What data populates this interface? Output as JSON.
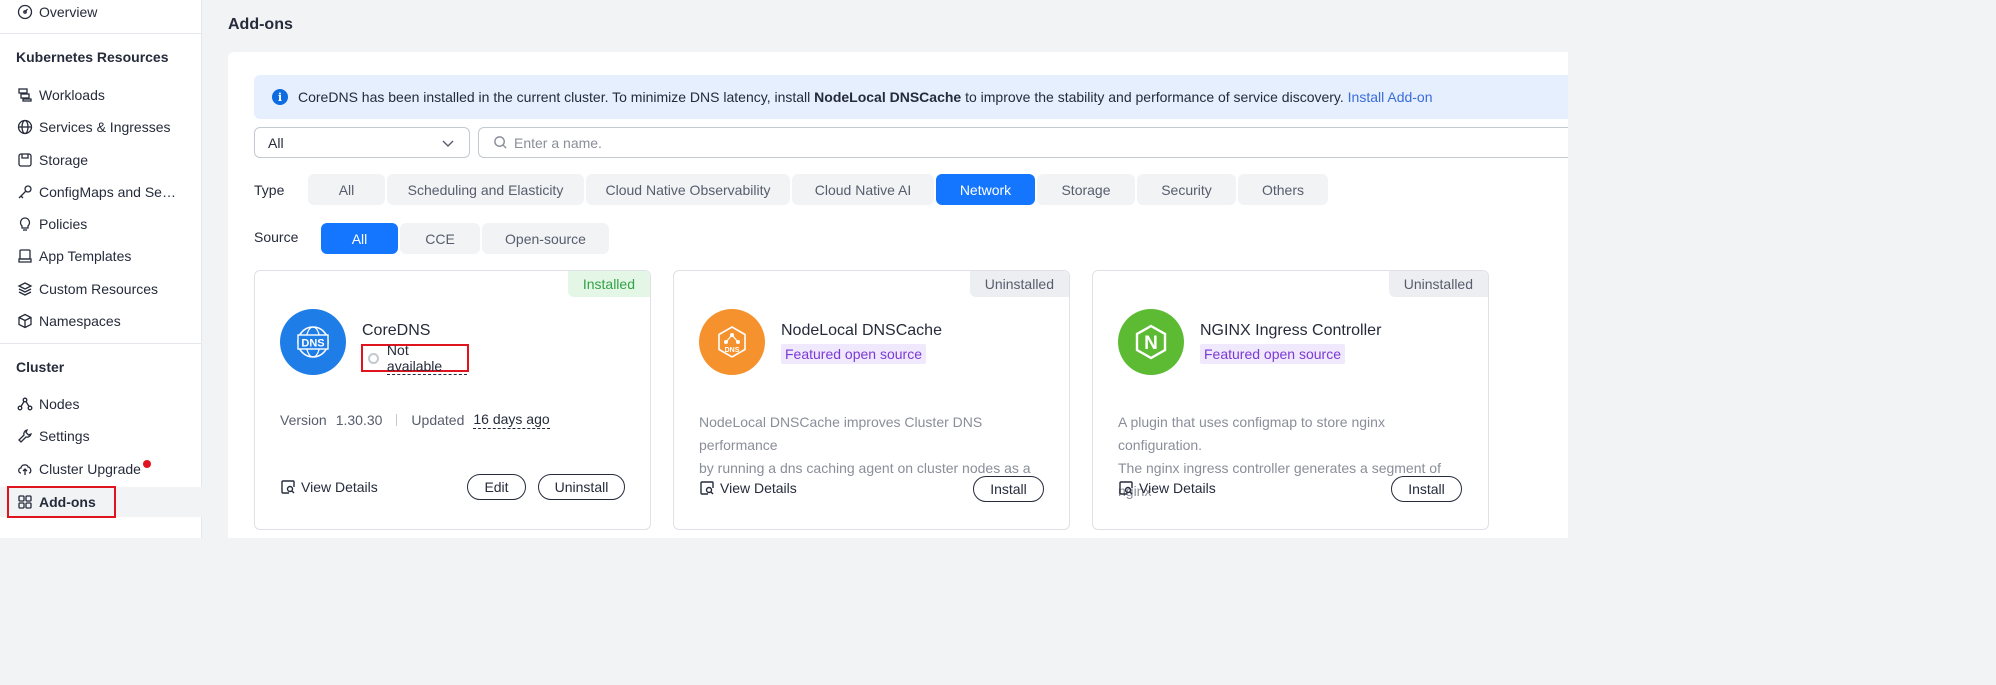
{
  "sidebar": {
    "overview": "Overview",
    "k8s_section": "Kubernetes Resources",
    "k8s_items": [
      {
        "label": "Workloads",
        "icon": "workloads-icon"
      },
      {
        "label": "Services & Ingresses",
        "icon": "globe-icon"
      },
      {
        "label": "Storage",
        "icon": "storage-icon"
      },
      {
        "label": "ConfigMaps and Se…",
        "icon": "key-icon"
      },
      {
        "label": "Policies",
        "icon": "lightbulb-icon"
      },
      {
        "label": "App Templates",
        "icon": "template-icon"
      },
      {
        "label": "Custom Resources",
        "icon": "layers-icon"
      },
      {
        "label": "Namespaces",
        "icon": "cube-icon"
      }
    ],
    "cluster_section": "Cluster",
    "cluster_items": [
      {
        "label": "Nodes",
        "icon": "nodes-icon"
      },
      {
        "label": "Settings",
        "icon": "wrench-icon"
      },
      {
        "label": "Cluster Upgrade",
        "icon": "cloud-upload-icon"
      },
      {
        "label": "Add-ons",
        "icon": "grid-icon"
      }
    ]
  },
  "main": {
    "title": "Add-ons",
    "banner": {
      "text_before": "CoreDNS has been installed in the current cluster. To minimize DNS latency, install ",
      "bold": "NodeLocal DNSCache",
      "text_after": " to improve the stability and performance of service discovery. ",
      "link": "Install Add-on"
    },
    "select_value": "All",
    "search_placeholder": "Enter a name.",
    "type_label": "Type",
    "type_filters": [
      "All",
      "Scheduling and Elasticity",
      "Cloud Native Observability",
      "Cloud Native AI",
      "Network",
      "Storage",
      "Security",
      "Others"
    ],
    "type_active": "Network",
    "source_label": "Source",
    "source_filters": [
      "All",
      "CCE",
      "Open-source"
    ],
    "source_active": "All"
  },
  "cards": [
    {
      "name": "CoreDNS",
      "status": "Installed",
      "state": "Not available",
      "version_label": "Version",
      "version": "1.30.30",
      "updated_label": "Updated",
      "updated": "16 days ago",
      "view_details": "View Details",
      "edit": "Edit",
      "uninstall": "Uninstall",
      "logo_color": "#1f7de8",
      "logo_text": "DNS"
    },
    {
      "name": "NodeLocal DNSCache",
      "status": "Uninstalled",
      "tag": "Featured open source",
      "desc_line1": "NodeLocal DNSCache improves Cluster DNS performance",
      "desc_line2": "by running a dns caching agent on cluster nodes as a",
      "view_details": "View Details",
      "install": "Install",
      "logo_color": "#f5922e",
      "logo_text": "DNS"
    },
    {
      "name": "NGINX Ingress Controller",
      "status": "Uninstalled",
      "tag": "Featured open source",
      "desc_line1": "A plugin that uses configmap to store nginx configuration.",
      "desc_line2": "The nginx ingress controller generates a segment of nginx",
      "view_details": "View Details",
      "install": "Install",
      "logo_color": "#5cbb32",
      "logo_text": "N"
    }
  ],
  "colors": {
    "accent": "#1476ff",
    "highlight_box": "#e0141e",
    "installed": "#33a248",
    "featured_bg": "#f0e8fc",
    "featured_text": "#7a3bd4"
  }
}
